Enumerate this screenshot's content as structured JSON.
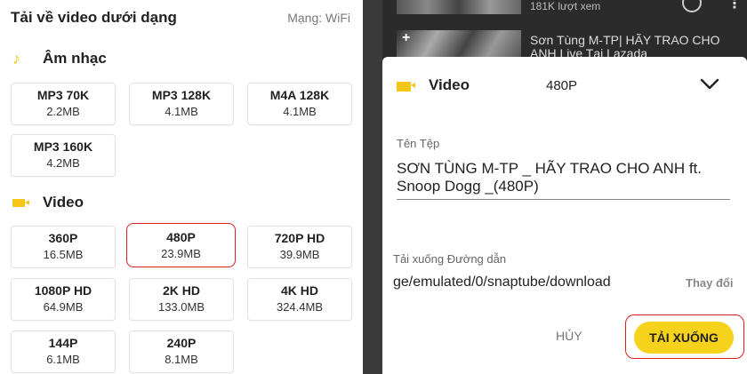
{
  "left": {
    "title": "Tải về video dưới dạng",
    "network": "Mạng: WiFi",
    "music_section": {
      "label": "Âm nhạc",
      "icon": "music-note-icon",
      "formats": [
        {
          "quality": "MP3 70K",
          "size": "2.2MB"
        },
        {
          "quality": "MP3 128K",
          "size": "4.1MB"
        },
        {
          "quality": "M4A 128K",
          "size": "4.1MB"
        },
        {
          "quality": "MP3 160K",
          "size": "4.2MB"
        }
      ]
    },
    "video_section": {
      "label": "Video",
      "icon": "video-camera-icon",
      "selected": "480P",
      "formats": [
        {
          "quality": "360P",
          "size": "16.5MB"
        },
        {
          "quality": "480P",
          "size": "23.9MB"
        },
        {
          "quality": "720P HD",
          "size": "39.9MB"
        },
        {
          "quality": "1080P HD",
          "size": "64.9MB"
        },
        {
          "quality": "2K HD",
          "size": "133.0MB"
        },
        {
          "quality": "4K HD",
          "size": "324.4MB"
        },
        {
          "quality": "144P",
          "size": "6.1MB"
        },
        {
          "quality": "240P",
          "size": "8.1MB"
        }
      ]
    },
    "colors": {
      "accent": "#f5c518",
      "selection": "#e02020"
    }
  },
  "right": {
    "background": {
      "views": "181K lượt xem",
      "video_title": "Sơn Tùng M-TP| HÃY TRAO CHO ANH Live Tại Lazada"
    },
    "sheet": {
      "type_label": "Video",
      "resolution": "480P",
      "file_name_label": "Tên Tệp",
      "file_name": "SƠN TÙNG M-TP _ HÃY TRAO CHO ANH ft. Snoop Dogg _(480P)",
      "path_label": "Tải xuống Đường dẫn",
      "path": "ge/emulated/0/snaptube/download",
      "change_label": "Thay đổi",
      "cancel_label": "HỦY",
      "download_label": "TẢI XUỐNG"
    },
    "colors": {
      "button": "#f7d21c",
      "highlight": "#e02020"
    }
  }
}
